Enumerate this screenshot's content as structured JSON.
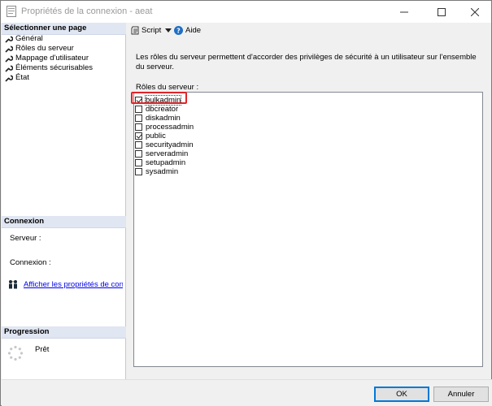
{
  "window": {
    "title": "Propriétés de la connexion - aeat"
  },
  "left_panel": {
    "select_page_header": "Sélectionner une page",
    "pages": [
      {
        "label": "Général"
      },
      {
        "label": "Rôles du serveur"
      },
      {
        "label": "Mappage d'utilisateur"
      },
      {
        "label": "Éléments sécurisables"
      },
      {
        "label": "État"
      }
    ],
    "connection_header": "Connexion",
    "server_label": "Serveur :",
    "connection_label": "Connexion :",
    "view_connection_link": "Afficher les propriétés de connexion",
    "progress_header": "Progression",
    "progress_status": "Prêt"
  },
  "toolbar": {
    "script_label": "Script",
    "help_label": "Aide"
  },
  "main": {
    "description": "Les rôles du serveur permettent d'accorder des privilèges de sécurité à un utilisateur sur l'ensemble du serveur.",
    "roles_label": "Rôles du serveur :",
    "roles": [
      {
        "name": "bulkadmin",
        "checked": true
      },
      {
        "name": "dbcreator",
        "checked": false
      },
      {
        "name": "diskadmin",
        "checked": false
      },
      {
        "name": "processadmin",
        "checked": false
      },
      {
        "name": "public",
        "checked": true
      },
      {
        "name": "securityadmin",
        "checked": false
      },
      {
        "name": "serveradmin",
        "checked": false
      },
      {
        "name": "setupadmin",
        "checked": false
      },
      {
        "name": "sysadmin",
        "checked": false
      }
    ],
    "highlight_color": "#e1242a"
  },
  "buttons": {
    "ok": "OK",
    "cancel": "Annuler"
  }
}
